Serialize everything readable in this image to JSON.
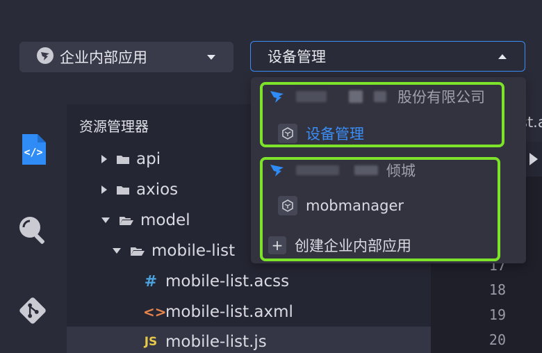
{
  "selectors": {
    "app_type": "企业内部应用",
    "app_name": "设备管理"
  },
  "explorer": {
    "title": "资源管理器",
    "tree": [
      {
        "name": "api",
        "kind": "folder",
        "expanded": false
      },
      {
        "name": "axios",
        "kind": "folder",
        "expanded": false
      },
      {
        "name": "model",
        "kind": "folder",
        "expanded": true
      },
      {
        "name": "mobile-list",
        "kind": "folder",
        "expanded": true
      },
      {
        "name": "mobile-list.acss",
        "kind": "file",
        "icon": "#"
      },
      {
        "name": "mobile-list.axml",
        "kind": "file",
        "icon": "<>"
      },
      {
        "name": "mobile-list.js",
        "kind": "file",
        "icon": "JS"
      }
    ]
  },
  "editor": {
    "tab_fragment": "st.a",
    "line_numbers": [
      "17",
      "18",
      "19",
      "20"
    ]
  },
  "dropdown": {
    "groups": [
      {
        "org": "股份有限公司",
        "apps": [
          {
            "name": "设备管理",
            "selected": true
          }
        ]
      },
      {
        "org": "倾城",
        "apps": [
          {
            "name": "mobmanager",
            "selected": false
          }
        ],
        "create_label": "创建企业内部应用"
      }
    ]
  },
  "colors": {
    "accent": "#3a8ef6",
    "highlight": "#7de22a",
    "background": "#2a2b38"
  }
}
